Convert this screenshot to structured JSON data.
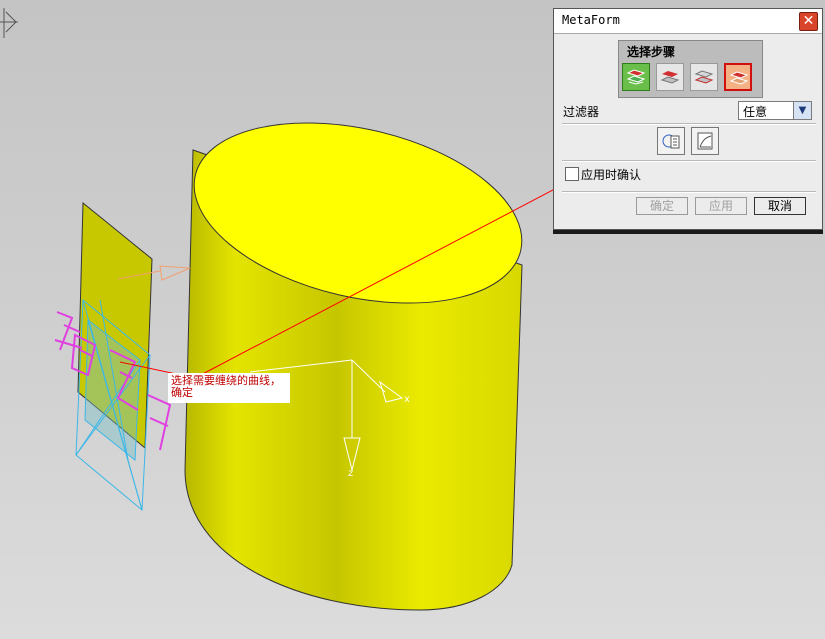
{
  "dialog": {
    "title": "MetaForm",
    "step_group_label": "选择步骤",
    "steps": [
      {
        "icon": "select-surface-green-icon",
        "state": "active"
      },
      {
        "icon": "surface-step-2-icon",
        "state": "normal"
      },
      {
        "icon": "surface-step-3-icon",
        "state": "normal"
      },
      {
        "icon": "wrap-curve-step-icon",
        "state": "selected"
      }
    ],
    "filter_label": "过滤器",
    "filter_value": "任意",
    "tools": [
      "curve-select-icon",
      "list-curves-icon"
    ],
    "confirm_on_apply_label": "应用时确认",
    "confirm_on_apply_checked": false,
    "buttons": {
      "ok": "确定",
      "apply": "应用",
      "cancel": "取消"
    }
  },
  "viewport": {
    "callout_text": "选择需要缠绕的曲线，\n确定",
    "handwriting_text": "我们学习",
    "axis_labels": {
      "x": "x",
      "z": "z"
    },
    "colors": {
      "cylinder": "#f2f200",
      "cylinder_shade": "#c9c900",
      "panel": "#c8c800",
      "handwriting": "#e040e0",
      "wireframe": "#3cb8e8",
      "leader_line": "#ff0000"
    }
  }
}
